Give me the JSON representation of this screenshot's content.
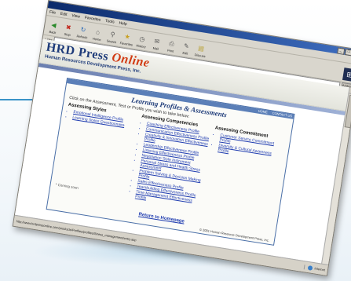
{
  "browser": {
    "window_controls": [
      "_",
      "□",
      "×"
    ],
    "menu": [
      "File",
      "Edit",
      "View",
      "Favorites",
      "Tools",
      "Help"
    ],
    "toolbar": [
      {
        "label": "Back",
        "icon": "back-arrow-icon"
      },
      {
        "label": "Stop",
        "icon": "stop-icon"
      },
      {
        "label": "Refresh",
        "icon": "refresh-icon"
      },
      {
        "label": "Home",
        "icon": "home-icon"
      },
      {
        "label": "Search",
        "icon": "search-icon"
      },
      {
        "label": "Favorites",
        "icon": "favorites-icon"
      },
      {
        "label": "History",
        "icon": "history-icon"
      },
      {
        "label": "Mail",
        "icon": "mail-icon"
      },
      {
        "label": "Print",
        "icon": "print-icon"
      },
      {
        "label": "Edit",
        "icon": "edit-icon"
      },
      {
        "label": "Discuss",
        "icon": "discuss-icon"
      }
    ],
    "address_label": "Links",
    "go_label": "Address",
    "status_url": "http://www.hrdpressonline.com/products/Profiles/profiles/Stress_management/entry.asp",
    "status_zone": "Internet"
  },
  "site": {
    "logo_main": "HRD Press",
    "logo_accent": "Online",
    "logo_sub": "Human Resources Development Press, Inc."
  },
  "page": {
    "nav_links": [
      "HOME",
      "CONTACT US"
    ],
    "title": "Learning Profiles & Assessments",
    "instruction": "Click on the Assessment, Test or Profile you wish to take below:",
    "columns": [
      {
        "title": "Assessing Styles",
        "items": [
          "Emotional Intelligence Profile",
          "Learning Styles Questionnaire"
        ]
      },
      {
        "title": "Assessing Competencies",
        "items": [
          "Coaching Effectiveness Profile",
          "Communication Effectiveness Profile",
          "Creativity & Innovation Effectiveness Profile",
          "Leadership Effectiveness Profile",
          "Listening Effectiveness Profile",
          "Negotiation Style Instrument",
          "Personal Stress and Health Stress Assessment",
          "Problem Solving & Decision Making Profile",
          "Sales Effectiveness Profile",
          "Teambuilding Effectiveness Profile",
          "Time Management Effectiveness Profile"
        ]
      },
      {
        "title": "Assessing Commitment",
        "items": [
          "Customer Service Commitment Profile",
          "Diversity & Cultural Awareness Profile"
        ]
      }
    ],
    "footnote": "* Coming soon",
    "return_link": "Return to Homepage",
    "copyright": "© 2001 Human Resource Development Press, Inc."
  }
}
